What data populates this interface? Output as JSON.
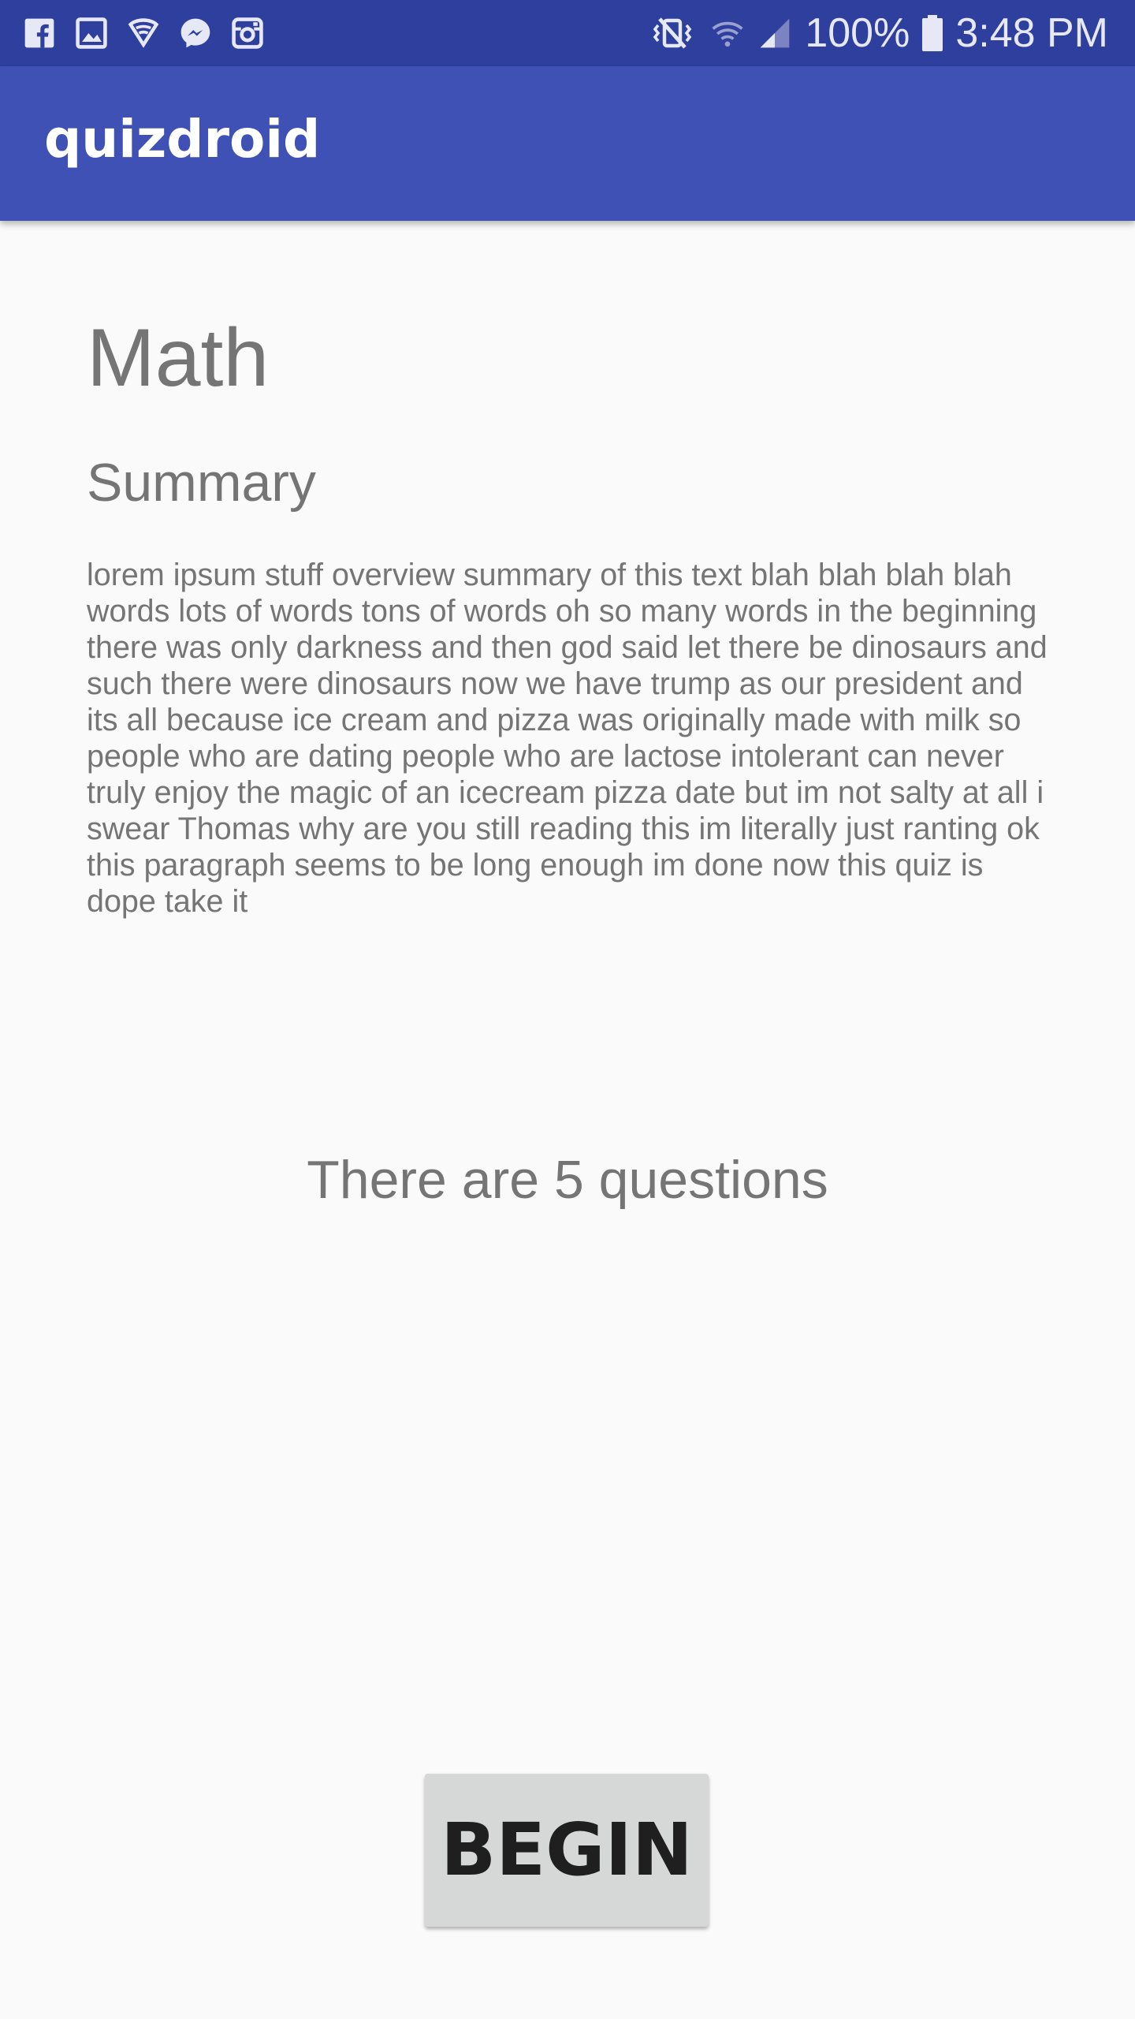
{
  "status_bar": {
    "left_icons": [
      "facebook-icon",
      "gallery-icon",
      "shield-icon",
      "messenger-icon",
      "instagram-icon"
    ],
    "right_icons": [
      "vibrate-icon",
      "wifi-icon",
      "signal-icon",
      "battery-icon"
    ],
    "battery_text": "100%",
    "time": "3:48 PM"
  },
  "app_bar": {
    "title": "quizdroid",
    "color": "#3f51b5",
    "status_color": "#2f3f9e"
  },
  "quiz": {
    "title": "Math",
    "summary_heading": "Summary",
    "summary_text": "lorem ipsum stuff overview summary of this text blah blah blah blah words lots of words tons of words oh so many words in the beginning there was only darkness and then god said let there be dinosaurs and such there were dinosaurs now we have trump as our president and its all because ice cream and pizza was originally made with milk so people who are dating people who are lactose intolerant can never truly enjoy the magic of an icecream pizza date but im not salty at all i swear Thomas why are you still reading this im literally just ranting ok this paragraph seems to be long enough im done now this quiz is dope take it",
    "question_count_text": "There are 5 questions",
    "begin_label": "BEGIN"
  }
}
